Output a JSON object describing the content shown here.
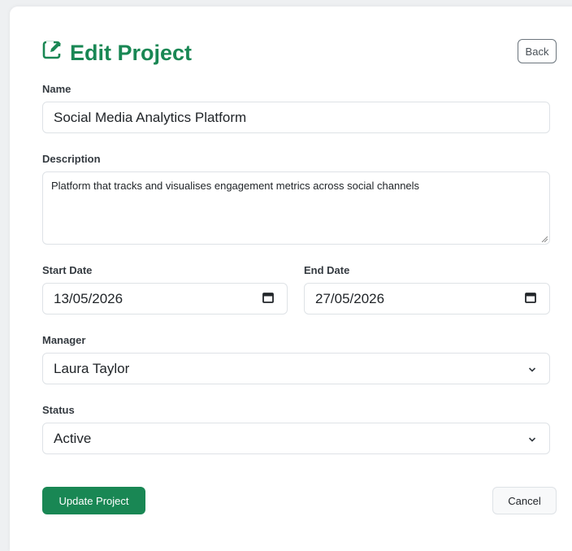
{
  "header": {
    "title": "Edit Project",
    "back_label": "Back"
  },
  "form": {
    "name": {
      "label": "Name",
      "value": "Social Media Analytics Platform"
    },
    "description": {
      "label": "Description",
      "value": "Platform that tracks and visualises engagement metrics across social channels"
    },
    "start_date": {
      "label": "Start Date",
      "value": "13/05/2026"
    },
    "end_date": {
      "label": "End Date",
      "value": "27/05/2026"
    },
    "manager": {
      "label": "Manager",
      "value": "Laura Taylor"
    },
    "status": {
      "label": "Status",
      "value": "Active"
    }
  },
  "actions": {
    "submit_label": "Update Project",
    "cancel_label": "Cancel"
  },
  "colors": {
    "accent": "#198754",
    "background": "#eef0f2",
    "border": "#dee2e6"
  },
  "icons": {
    "title": "edit-square-icon",
    "date": "calendar-icon",
    "select": "chevron-down-icon"
  }
}
